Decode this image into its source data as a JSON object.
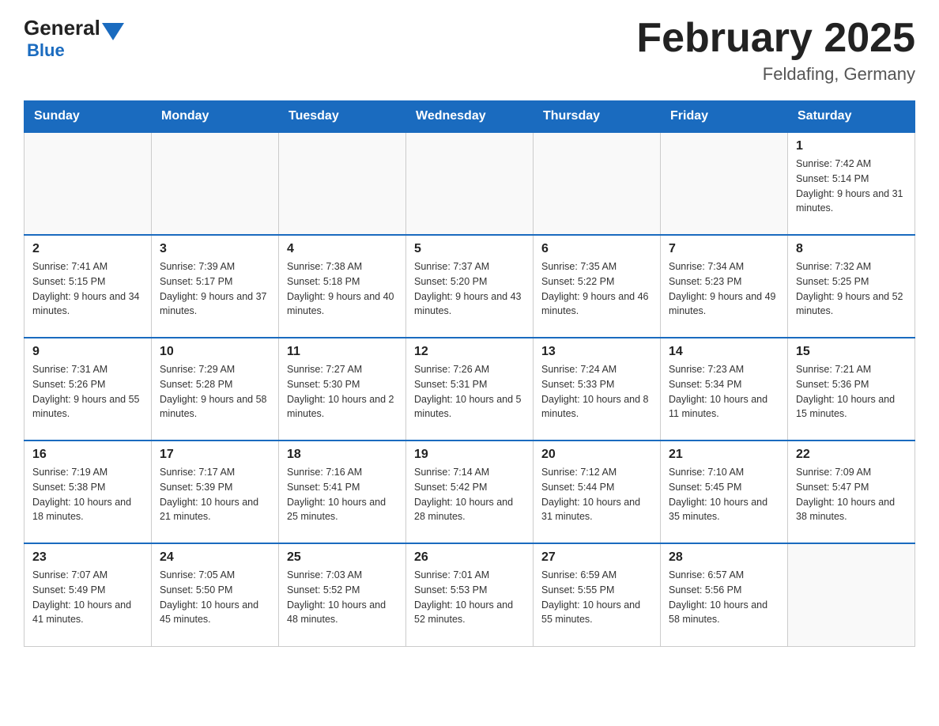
{
  "header": {
    "logo_text_general": "General",
    "logo_text_blue": "Blue",
    "month_title": "February 2025",
    "location": "Feldafing, Germany"
  },
  "days_of_week": [
    "Sunday",
    "Monday",
    "Tuesday",
    "Wednesday",
    "Thursday",
    "Friday",
    "Saturday"
  ],
  "weeks": [
    [
      {
        "day": "",
        "info": ""
      },
      {
        "day": "",
        "info": ""
      },
      {
        "day": "",
        "info": ""
      },
      {
        "day": "",
        "info": ""
      },
      {
        "day": "",
        "info": ""
      },
      {
        "day": "",
        "info": ""
      },
      {
        "day": "1",
        "info": "Sunrise: 7:42 AM\nSunset: 5:14 PM\nDaylight: 9 hours and 31 minutes."
      }
    ],
    [
      {
        "day": "2",
        "info": "Sunrise: 7:41 AM\nSunset: 5:15 PM\nDaylight: 9 hours and 34 minutes."
      },
      {
        "day": "3",
        "info": "Sunrise: 7:39 AM\nSunset: 5:17 PM\nDaylight: 9 hours and 37 minutes."
      },
      {
        "day": "4",
        "info": "Sunrise: 7:38 AM\nSunset: 5:18 PM\nDaylight: 9 hours and 40 minutes."
      },
      {
        "day": "5",
        "info": "Sunrise: 7:37 AM\nSunset: 5:20 PM\nDaylight: 9 hours and 43 minutes."
      },
      {
        "day": "6",
        "info": "Sunrise: 7:35 AM\nSunset: 5:22 PM\nDaylight: 9 hours and 46 minutes."
      },
      {
        "day": "7",
        "info": "Sunrise: 7:34 AM\nSunset: 5:23 PM\nDaylight: 9 hours and 49 minutes."
      },
      {
        "day": "8",
        "info": "Sunrise: 7:32 AM\nSunset: 5:25 PM\nDaylight: 9 hours and 52 minutes."
      }
    ],
    [
      {
        "day": "9",
        "info": "Sunrise: 7:31 AM\nSunset: 5:26 PM\nDaylight: 9 hours and 55 minutes."
      },
      {
        "day": "10",
        "info": "Sunrise: 7:29 AM\nSunset: 5:28 PM\nDaylight: 9 hours and 58 minutes."
      },
      {
        "day": "11",
        "info": "Sunrise: 7:27 AM\nSunset: 5:30 PM\nDaylight: 10 hours and 2 minutes."
      },
      {
        "day": "12",
        "info": "Sunrise: 7:26 AM\nSunset: 5:31 PM\nDaylight: 10 hours and 5 minutes."
      },
      {
        "day": "13",
        "info": "Sunrise: 7:24 AM\nSunset: 5:33 PM\nDaylight: 10 hours and 8 minutes."
      },
      {
        "day": "14",
        "info": "Sunrise: 7:23 AM\nSunset: 5:34 PM\nDaylight: 10 hours and 11 minutes."
      },
      {
        "day": "15",
        "info": "Sunrise: 7:21 AM\nSunset: 5:36 PM\nDaylight: 10 hours and 15 minutes."
      }
    ],
    [
      {
        "day": "16",
        "info": "Sunrise: 7:19 AM\nSunset: 5:38 PM\nDaylight: 10 hours and 18 minutes."
      },
      {
        "day": "17",
        "info": "Sunrise: 7:17 AM\nSunset: 5:39 PM\nDaylight: 10 hours and 21 minutes."
      },
      {
        "day": "18",
        "info": "Sunrise: 7:16 AM\nSunset: 5:41 PM\nDaylight: 10 hours and 25 minutes."
      },
      {
        "day": "19",
        "info": "Sunrise: 7:14 AM\nSunset: 5:42 PM\nDaylight: 10 hours and 28 minutes."
      },
      {
        "day": "20",
        "info": "Sunrise: 7:12 AM\nSunset: 5:44 PM\nDaylight: 10 hours and 31 minutes."
      },
      {
        "day": "21",
        "info": "Sunrise: 7:10 AM\nSunset: 5:45 PM\nDaylight: 10 hours and 35 minutes."
      },
      {
        "day": "22",
        "info": "Sunrise: 7:09 AM\nSunset: 5:47 PM\nDaylight: 10 hours and 38 minutes."
      }
    ],
    [
      {
        "day": "23",
        "info": "Sunrise: 7:07 AM\nSunset: 5:49 PM\nDaylight: 10 hours and 41 minutes."
      },
      {
        "day": "24",
        "info": "Sunrise: 7:05 AM\nSunset: 5:50 PM\nDaylight: 10 hours and 45 minutes."
      },
      {
        "day": "25",
        "info": "Sunrise: 7:03 AM\nSunset: 5:52 PM\nDaylight: 10 hours and 48 minutes."
      },
      {
        "day": "26",
        "info": "Sunrise: 7:01 AM\nSunset: 5:53 PM\nDaylight: 10 hours and 52 minutes."
      },
      {
        "day": "27",
        "info": "Sunrise: 6:59 AM\nSunset: 5:55 PM\nDaylight: 10 hours and 55 minutes."
      },
      {
        "day": "28",
        "info": "Sunrise: 6:57 AM\nSunset: 5:56 PM\nDaylight: 10 hours and 58 minutes."
      },
      {
        "day": "",
        "info": ""
      }
    ]
  ]
}
